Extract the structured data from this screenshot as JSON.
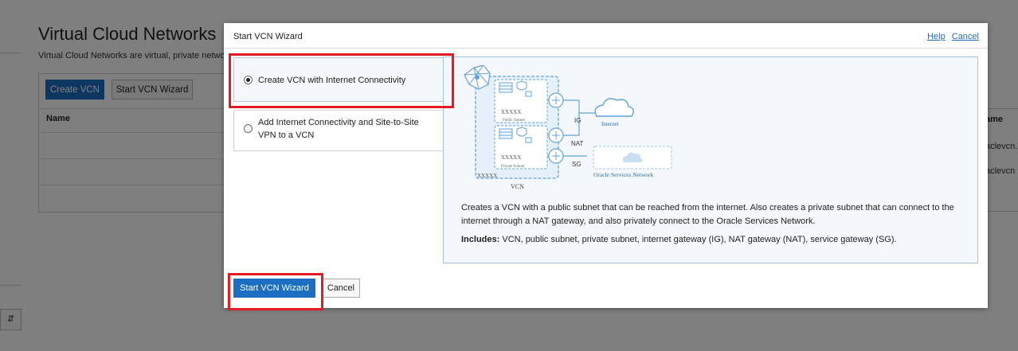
{
  "background": {
    "page_title": "Virtual Cloud Networks",
    "page_subtitle": "Virtual Cloud Networks are virtual, private netwo",
    "create_vcn_label": "Create VCN",
    "start_wizard_label": "Start VCN Wizard",
    "name_column": "Name",
    "right_column": "ame",
    "right_rows": [
      "aclevcn.",
      "aclevcn"
    ]
  },
  "dialog": {
    "title": "Start VCN Wizard",
    "help_link": "Help",
    "cancel_link": "Cancel",
    "options": [
      {
        "label_line1": "Create VCN with Internet Connectivity",
        "label_line2": "",
        "selected": true
      },
      {
        "label_line1": "Add Internet Connectivity and Site-to-Site",
        "label_line2": "VPN to a VCN",
        "selected": false
      }
    ],
    "diagram": {
      "public_subnet": "Public Subnet",
      "private_subnet": "Private Subnet",
      "placeholder": "XXXXX",
      "vcn": "VCN",
      "ig": "IG",
      "nat": "NAT",
      "sg": "SG",
      "internet": "Internet",
      "oracle_services": "Oracle Services Network"
    },
    "description": "Creates a VCN with a public subnet that can be reached from the internet. Also creates a private subnet that can connect to the internet through a NAT gateway, and also privately connect to the Oracle Services Network.",
    "includes_label": "Includes:",
    "includes_text": " VCN, public subnet, private subnet, internet gateway (IG), NAT gateway (NAT), service gateway (SG).",
    "start_button": "Start VCN Wizard",
    "cancel_button": "Cancel"
  },
  "colors": {
    "accent": "#1b6ec2",
    "highlight": "#e21b24",
    "diagram_blue": "#5fa3dc"
  }
}
